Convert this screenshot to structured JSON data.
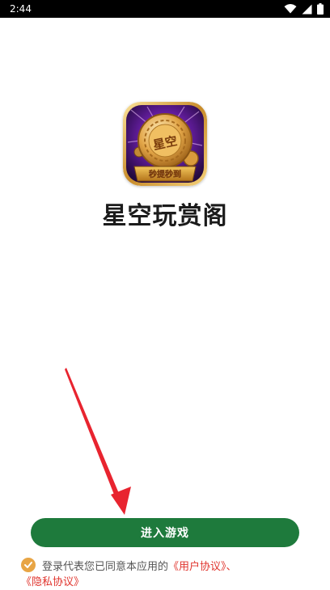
{
  "status_bar": {
    "time": "2:44"
  },
  "app": {
    "name": "星空玩赏阁",
    "icon_text": "星空",
    "icon_banner": "秒提秒到"
  },
  "button": {
    "label": "进入游戏"
  },
  "agreement": {
    "prefix": "登录代表您已同意本应用的",
    "user_agreement": "《用户协议》",
    "separator": "、",
    "privacy_policy": "《隐私协议》"
  },
  "colors": {
    "button_bg": "#1e7a3c",
    "link": "#e0342d",
    "check": "#e8a545",
    "arrow": "#e8242f"
  }
}
